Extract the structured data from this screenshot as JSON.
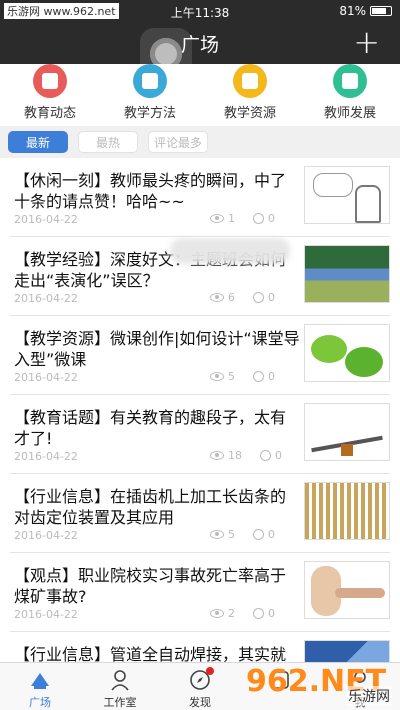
{
  "status_bar": {
    "watermark": "乐游网 www.962.net",
    "time": "上午11:38",
    "battery": "81%"
  },
  "nav": {
    "title": "广场",
    "action_icon": "plus-icon"
  },
  "categories": [
    {
      "label": "教育动态",
      "color": "#e85b5b"
    },
    {
      "label": "教学方法",
      "color": "#3aa9d8"
    },
    {
      "label": "教学资源",
      "color": "#f2b81c"
    },
    {
      "label": "教师发展",
      "color": "#2fbf92"
    }
  ],
  "tabs": [
    "最新",
    "最热",
    "评论最多"
  ],
  "articles": [
    {
      "title": "【休闲一刻】教师最头疼的瞬间，中了十条的请点赞！哈哈~~",
      "date": "2016-04-22",
      "views": "1",
      "comments": "0",
      "thumb": "th-cartoon"
    },
    {
      "title": "【教学经验】深度好文：主题班会如何走出“表演化”误区？",
      "date": "2016-04-22",
      "views": "6",
      "comments": "0",
      "thumb": "th-class"
    },
    {
      "title": "【教学资源】微课创作|如何设计“课堂导入型”微课",
      "date": "2016-04-22",
      "views": "5",
      "comments": "0",
      "thumb": "th-micro"
    },
    {
      "title": "【教育话题】有关教育的趣段子，太有才了!",
      "date": "2016-04-22",
      "views": "18",
      "comments": "0",
      "thumb": "th-seesaw"
    },
    {
      "title": "【行业信息】在插齿机上加工长齿条的对齿定位装置及其应用",
      "date": "2016-04-22",
      "views": "5",
      "comments": "0",
      "thumb": "th-gear"
    },
    {
      "title": "【观点】职业院校实习事故死亡率高于煤矿事故?",
      "date": "2016-04-22",
      "views": "2",
      "comments": "0",
      "thumb": "th-nose"
    },
    {
      "title": "【行业信息】管道全自动焊接，其实就这么简单",
      "date": "",
      "views": "",
      "comments": "",
      "thumb": "th-blue"
    }
  ],
  "tabbar": [
    {
      "label": "广场",
      "icon": "plaza-icon",
      "active": true
    },
    {
      "label": "工作室",
      "icon": "person-icon",
      "active": false
    },
    {
      "label": "发现",
      "icon": "discover-icon",
      "active": false,
      "badge": true
    },
    {
      "label": "",
      "icon": "more-icon",
      "active": false
    },
    {
      "label": "我",
      "icon": "me-icon",
      "active": false
    }
  ],
  "watermark_bottom": {
    "logo": "962.NET",
    "text": "乐游网"
  }
}
